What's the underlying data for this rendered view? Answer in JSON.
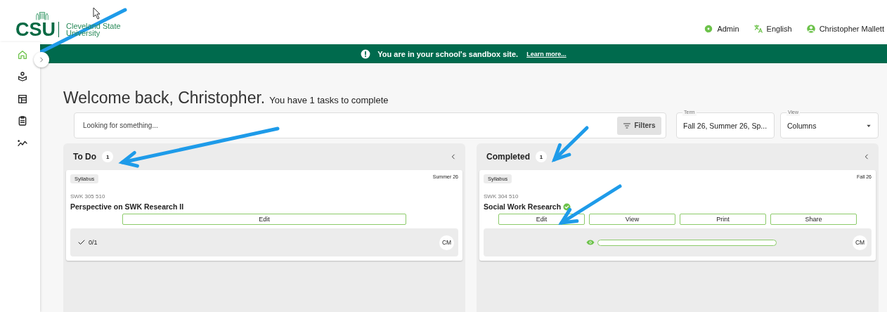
{
  "logo": {
    "mark": "CSU",
    "name_line1": "Cleveland State",
    "name_line2": "University"
  },
  "header_links": [
    {
      "kind": "admin",
      "label": "Admin"
    },
    {
      "kind": "language",
      "label": "English"
    },
    {
      "kind": "user",
      "label": "Christopher Mallett"
    }
  ],
  "banner": {
    "message": "You are in your school's sandbox site.",
    "link": "Learn more..."
  },
  "sidebar": {
    "items": [
      {
        "kind": "home",
        "selected": true
      },
      {
        "kind": "courses",
        "selected": false
      },
      {
        "kind": "layout",
        "selected": false
      },
      {
        "kind": "clipboard",
        "selected": false
      },
      {
        "kind": "analytics",
        "selected": false
      }
    ]
  },
  "heading": {
    "title": "Welcome back, Christopher.",
    "subtitle": "You have 1 tasks to complete"
  },
  "search": {
    "placeholder": "Looking for something...",
    "filters_button": "Filters"
  },
  "selects": [
    {
      "label": "Term",
      "value": "Fall 26, Summer 26, Sp..."
    },
    {
      "label": "View",
      "value": "Columns"
    }
  ],
  "columns": [
    {
      "title": "To Do",
      "count": "1",
      "cards": [
        {
          "tag": "Syllabus",
          "term": "Summer 26",
          "code": "SWK 305 510",
          "title": "Perspective on SWK Research II",
          "verified": false,
          "actions": [
            "Edit"
          ],
          "footer": {
            "kind": "count",
            "text": "0/1",
            "avatar": "CM"
          }
        }
      ]
    },
    {
      "title": "Completed",
      "count": "1",
      "cards": [
        {
          "tag": "Syllabus",
          "term": "Fall 26",
          "code": "SWK 304 510",
          "title": "Social Work Research",
          "verified": true,
          "actions": [
            "Edit",
            "View",
            "Print",
            "Share"
          ],
          "footer": {
            "kind": "bar",
            "level": 0,
            "avatar": "CM"
          }
        }
      ]
    }
  ]
}
